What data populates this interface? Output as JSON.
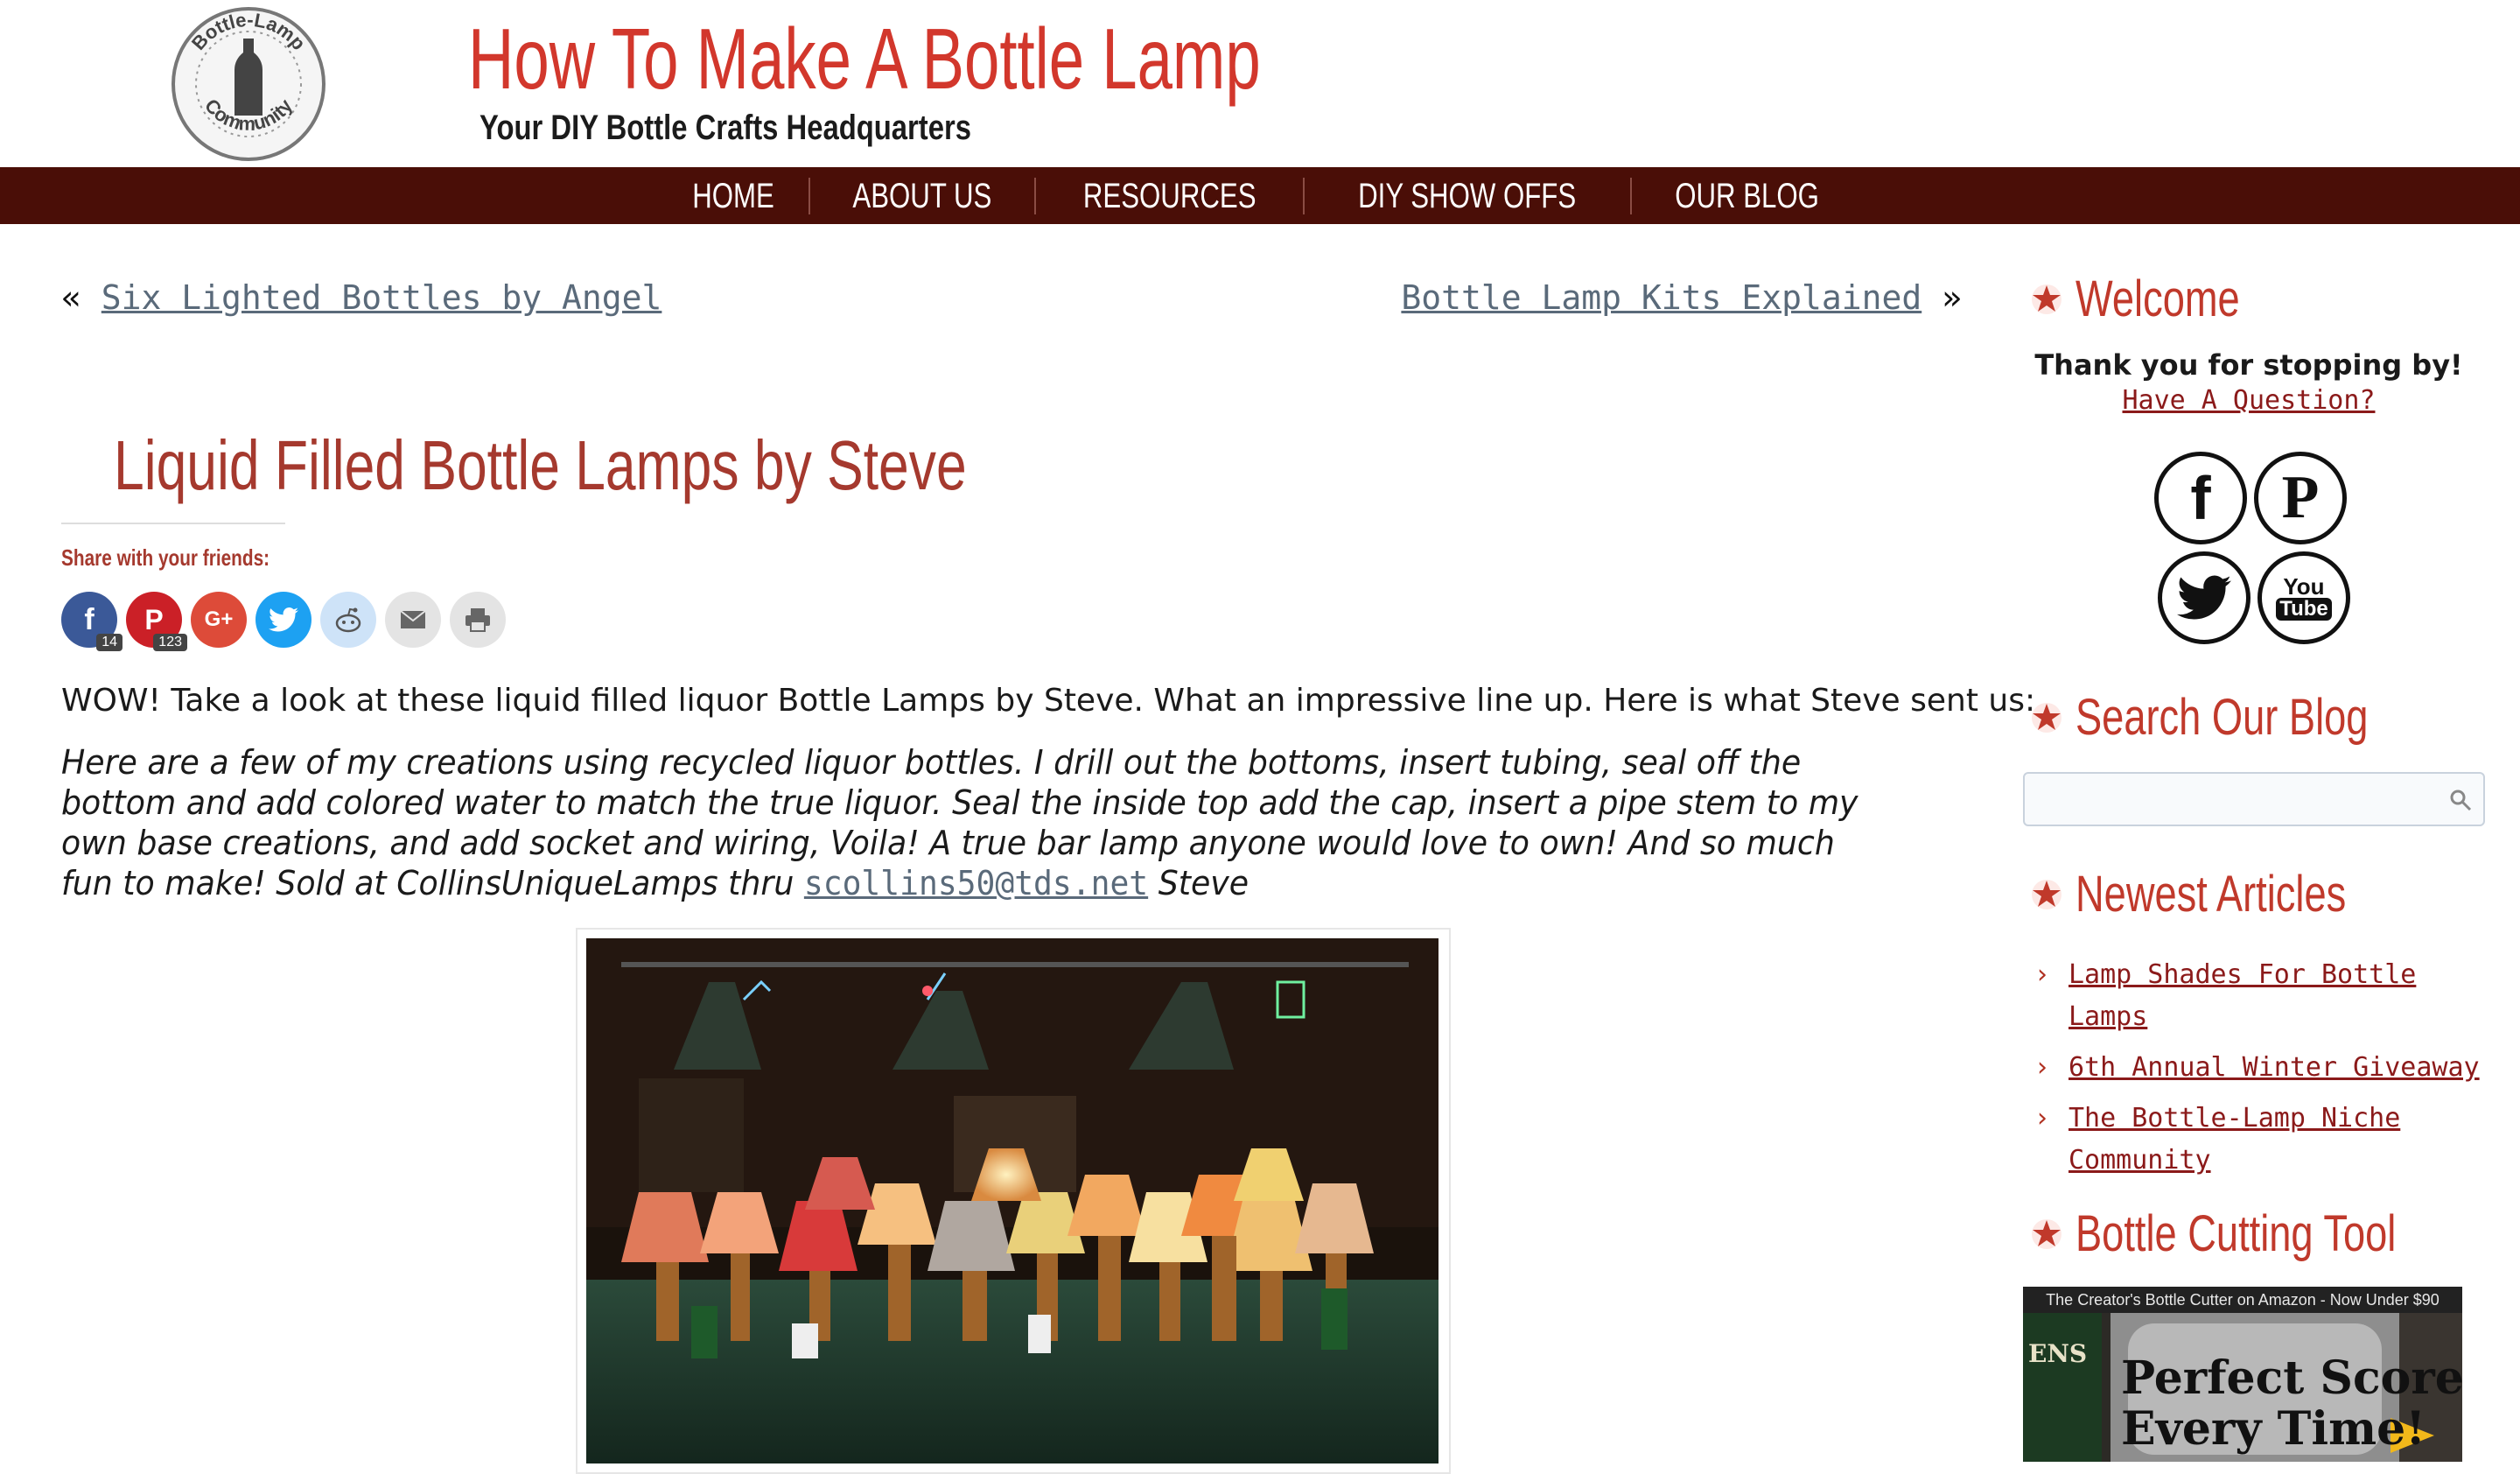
{
  "header": {
    "logo_top_text": "Bottle-Lamp",
    "logo_bottom_text": "Community",
    "title": "How To Make A Bottle Lamp",
    "tagline": "Your DIY Bottle Crafts Headquarters"
  },
  "nav": {
    "items": [
      "HOME",
      "ABOUT US",
      "RESOURCES",
      "DIY SHOW OFFS",
      "OUR BLOG"
    ]
  },
  "post_nav": {
    "prev_arrow": "«",
    "prev_label": "Six Lighted Bottles by Angel",
    "next_label": "Bottle Lamp Kits Explained",
    "next_arrow": "»"
  },
  "post": {
    "title": "Liquid Filled Bottle Lamps by Steve",
    "share_label": "Share with your friends:",
    "share_buttons": [
      {
        "icon": "facebook-icon",
        "glyph": "f",
        "color": "#3b5998",
        "count": "14"
      },
      {
        "icon": "pinterest-icon",
        "glyph": "P",
        "color": "#cb2027",
        "count": "123"
      },
      {
        "icon": "google-plus-icon",
        "glyph": "G+",
        "color": "#dd4b39"
      },
      {
        "icon": "twitter-icon",
        "glyph": "t",
        "color": "#1da1f2"
      },
      {
        "icon": "reddit-icon",
        "glyph": "r",
        "color": "#cee3f8"
      },
      {
        "icon": "email-icon",
        "glyph": "✉",
        "color": "#e4e4e4"
      },
      {
        "icon": "print-icon",
        "glyph": "⎙",
        "color": "#e4e4e4"
      }
    ],
    "intro": "WOW! Take a look at these liquid filled liquor Bottle Lamps by Steve. What an impressive line up. Here is what Steve sent us:",
    "quote_text": "Here are a few of my creations using recycled liquor bottles.   I drill out the bottoms, insert tubing, seal off the bottom and add colored water to match the true liquor.  Seal the inside top add the cap,  insert a pipe stem to my own  base creations, and add socket and wiring, Voila!   A true bar lamp anyone would love to own!  And so much fun to make!   Sold at   CollinsUniqueLamps thru ",
    "quote_email": "scollins50@tds.net",
    "quote_sign": " Steve"
  },
  "sidebar": {
    "welcome": {
      "title": "Welcome",
      "text": "Thank you for stopping by!",
      "link": "Have A Question?",
      "social": [
        {
          "icon": "facebook-icon",
          "glyph": "f"
        },
        {
          "icon": "pinterest-icon",
          "glyph": "P"
        },
        {
          "icon": "twitter-icon",
          "glyph": "🐦"
        },
        {
          "icon": "youtube-icon",
          "glyph_top": "You",
          "glyph_bottom": "Tube"
        }
      ]
    },
    "search": {
      "title": "Search Our Blog",
      "placeholder": ""
    },
    "newest": {
      "title": "Newest Articles",
      "items": [
        "Lamp Shades For Bottle Lamps",
        "6th Annual Winter Giveaway",
        "The Bottle-Lamp Niche Community"
      ]
    },
    "tool": {
      "title": "Bottle Cutting Tool",
      "ad_top": "The Creator's Bottle Cutter on Amazon - Now Under $90",
      "ad_line1": "Perfect Score",
      "ad_line2": "Every Time!",
      "ad_side": "ENS"
    }
  },
  "colors": {
    "brand_red": "#d2372c",
    "nav_bg": "#4a0e07",
    "link_gray": "#5a6a7a",
    "sidebar_link": "#8b1a1a"
  }
}
